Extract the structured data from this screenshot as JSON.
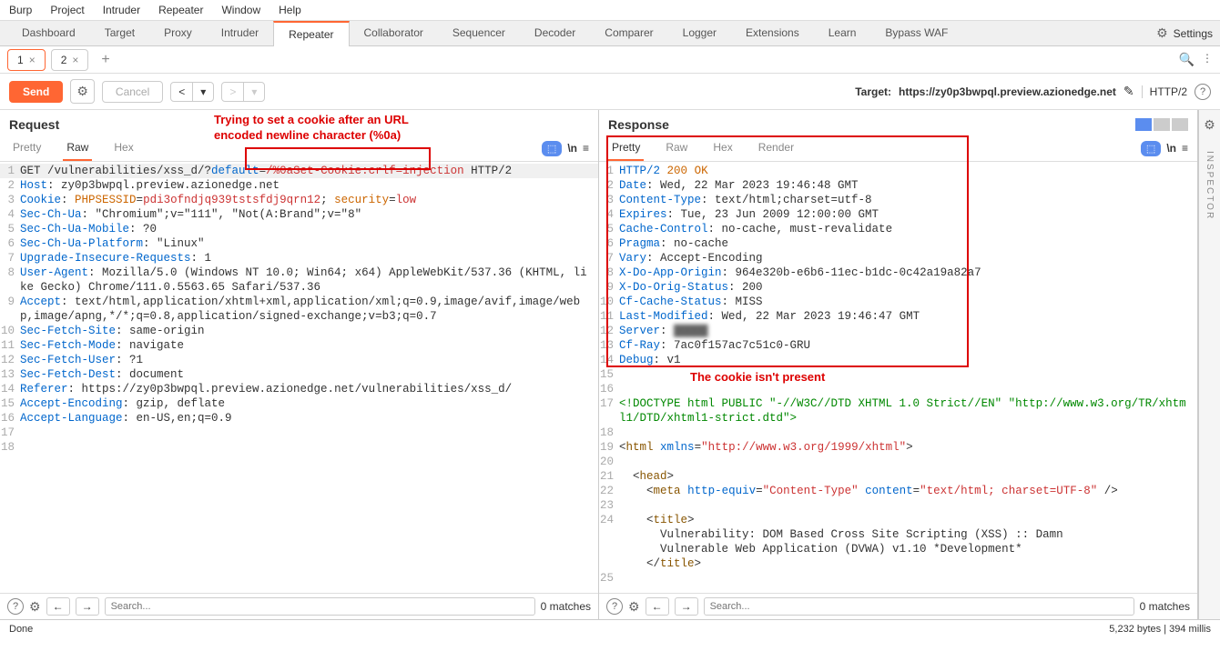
{
  "menubar": [
    "Burp",
    "Project",
    "Intruder",
    "Repeater",
    "Window",
    "Help"
  ],
  "toolbar": {
    "tabs": [
      "Dashboard",
      "Target",
      "Proxy",
      "Intruder",
      "Repeater",
      "Collaborator",
      "Sequencer",
      "Decoder",
      "Comparer",
      "Logger",
      "Extensions",
      "Learn",
      "Bypass WAF"
    ],
    "active": "Repeater",
    "settings": "Settings"
  },
  "subtabs": {
    "tab1": "1",
    "tab2": "2",
    "active": "1"
  },
  "actionbar": {
    "send": "Send",
    "cancel": "Cancel",
    "target_label": "Target:",
    "target_url": "https://zy0p3bwpql.preview.azionedge.net",
    "protocol": "HTTP/2"
  },
  "annotations": {
    "req_text": "Trying to set a cookie after an URL\nencoded newline character (%0a)",
    "resp_text": "The cookie isn't present"
  },
  "request": {
    "title": "Request",
    "view_tabs": [
      "Pretty",
      "Raw",
      "Hex"
    ],
    "active_view": "Raw",
    "lines": [
      {
        "n": 1,
        "html": "GET /vulnerabilities/xss_d/?<span class='h-blue'>default</span>=<span class='h-red'>/%0aSet-Cookie:crlf=injection</span> HTTP/2",
        "cls": "highlight-bg"
      },
      {
        "n": 2,
        "html": "<span class='h-blue'>Host</span>: zy0p3bwpql.preview.azionedge.net"
      },
      {
        "n": 3,
        "html": "<span class='h-blue'>Cookie</span>: <span class='h-orange'>PHPSESSID</span>=<span class='h-red'>pdi3ofndjq939tstsfdj9qrn12</span>; <span class='h-orange'>security</span>=<span class='h-red'>low</span>"
      },
      {
        "n": 4,
        "html": "<span class='h-blue'>Sec-Ch-Ua</span>: \"Chromium\";v=\"111\", \"Not(A:Brand\";v=\"8\""
      },
      {
        "n": 5,
        "html": "<span class='h-blue'>Sec-Ch-Ua-Mobile</span>: ?0"
      },
      {
        "n": 6,
        "html": "<span class='h-blue'>Sec-Ch-Ua-Platform</span>: \"Linux\""
      },
      {
        "n": 7,
        "html": "<span class='h-blue'>Upgrade-Insecure-Requests</span>: 1"
      },
      {
        "n": 8,
        "html": "<span class='h-blue'>User-Agent</span>: Mozilla/5.0 (Windows NT 10.0; Win64; x64) AppleWebKit/537.36 (KHTML, like Gecko) Chrome/111.0.5563.65 Safari/537.36"
      },
      {
        "n": 9,
        "html": "<span class='h-blue'>Accept</span>: text/html,application/xhtml+xml,application/xml;q=0.9,image/avif,image/webp,image/apng,*/*;q=0.8,application/signed-exchange;v=b3;q=0.7"
      },
      {
        "n": 10,
        "html": "<span class='h-blue'>Sec-Fetch-Site</span>: same-origin"
      },
      {
        "n": 11,
        "html": "<span class='h-blue'>Sec-Fetch-Mode</span>: navigate"
      },
      {
        "n": 12,
        "html": "<span class='h-blue'>Sec-Fetch-User</span>: ?1"
      },
      {
        "n": 13,
        "html": "<span class='h-blue'>Sec-Fetch-Dest</span>: document"
      },
      {
        "n": 14,
        "html": "<span class='h-blue'>Referer</span>: https://zy0p3bwpql.preview.azionedge.net/vulnerabilities/xss_d/"
      },
      {
        "n": 15,
        "html": "<span class='h-blue'>Accept-Encoding</span>: gzip, deflate"
      },
      {
        "n": 16,
        "html": "<span class='h-blue'>Accept-Language</span>: en-US,en;q=0.9"
      },
      {
        "n": 17,
        "html": ""
      },
      {
        "n": 18,
        "html": ""
      }
    ]
  },
  "response": {
    "title": "Response",
    "view_tabs": [
      "Pretty",
      "Raw",
      "Hex",
      "Render"
    ],
    "active_view": "Pretty",
    "lines": [
      {
        "n": 1,
        "html": "<span class='h-blue'>HTTP/2</span> <span class='h-orange'>200</span> <span class='h-orange'>OK</span>"
      },
      {
        "n": 2,
        "html": "<span class='h-blue'>Date</span>: Wed, 22 Mar 2023 19:46:48 GMT"
      },
      {
        "n": 3,
        "html": "<span class='h-blue'>Content-Type</span>: text/html;charset=utf-8"
      },
      {
        "n": 4,
        "html": "<span class='h-blue'>Expires</span>: Tue, 23 Jun 2009 12:00:00 GMT"
      },
      {
        "n": 5,
        "html": "<span class='h-blue'>Cache-Control</span>: no-cache, must-revalidate"
      },
      {
        "n": 6,
        "html": "<span class='h-blue'>Pragma</span>: no-cache"
      },
      {
        "n": 7,
        "html": "<span class='h-blue'>Vary</span>: Accept-Encoding"
      },
      {
        "n": 8,
        "html": "<span class='h-blue'>X-Do-App-Origin</span>: 964e320b-e6b6-11ec-b1dc-0c42a19a82a7"
      },
      {
        "n": 9,
        "html": "<span class='h-blue'>X-Do-Orig-Status</span>: 200"
      },
      {
        "n": 10,
        "html": "<span class='h-blue'>Cf-Cache-Status</span>: MISS"
      },
      {
        "n": 11,
        "html": "<span class='h-blue'>Last-Modified</span>: Wed, 22 Mar 2023 19:46:47 GMT"
      },
      {
        "n": 12,
        "html": "<span class='h-blue'>Server</span>: <span style='filter:blur(2px)'>▓▓▓▓▓</span>"
      },
      {
        "n": 13,
        "html": "<span class='h-blue'>Cf-Ray</span>: 7ac0f157ac7c51c0-GRU"
      },
      {
        "n": 14,
        "html": "<span class='h-blue'>Debug</span>: v1"
      },
      {
        "n": 15,
        "html": ""
      },
      {
        "n": 16,
        "html": ""
      },
      {
        "n": 17,
        "html": "<span class='h-green'>&lt;!DOCTYPE html PUBLIC \"-//W3C//DTD XHTML 1.0 Strict//EN\" \"http://www.w3.org/TR/xhtml1/DTD/xhtml1-strict.dtd\"&gt;</span>"
      },
      {
        "n": 18,
        "html": ""
      },
      {
        "n": 19,
        "html": "&lt;<span class='h-brown'>html</span> <span class='h-blue'>xmlns</span>=<span class='h-red'>\"http://www.w3.org/1999/xhtml\"</span>&gt;"
      },
      {
        "n": 20,
        "html": ""
      },
      {
        "n": 21,
        "html": "  &lt;<span class='h-brown'>head</span>&gt;"
      },
      {
        "n": 22,
        "html": "    &lt;<span class='h-brown'>meta</span> <span class='h-blue'>http-equiv</span>=<span class='h-red'>\"Content-Type\"</span> <span class='h-blue'>content</span>=<span class='h-red'>\"text/html; charset=UTF-8\"</span> /&gt;"
      },
      {
        "n": 23,
        "html": ""
      },
      {
        "n": 24,
        "html": "    &lt;<span class='h-brown'>title</span>&gt;\n      Vulnerability: DOM Based Cross Site Scripting (XSS) :: Damn\n      Vulnerable Web Application (DVWA) v1.10 *Development*\n    &lt;/<span class='h-brown'>title</span>&gt;"
      },
      {
        "n": 25,
        "html": ""
      }
    ]
  },
  "footer": {
    "search_placeholder": "Search...",
    "matches": "0 matches"
  },
  "inspector": "INSPECTOR",
  "statusbar": {
    "left": "Done",
    "right": "5,232 bytes | 394 millis"
  }
}
